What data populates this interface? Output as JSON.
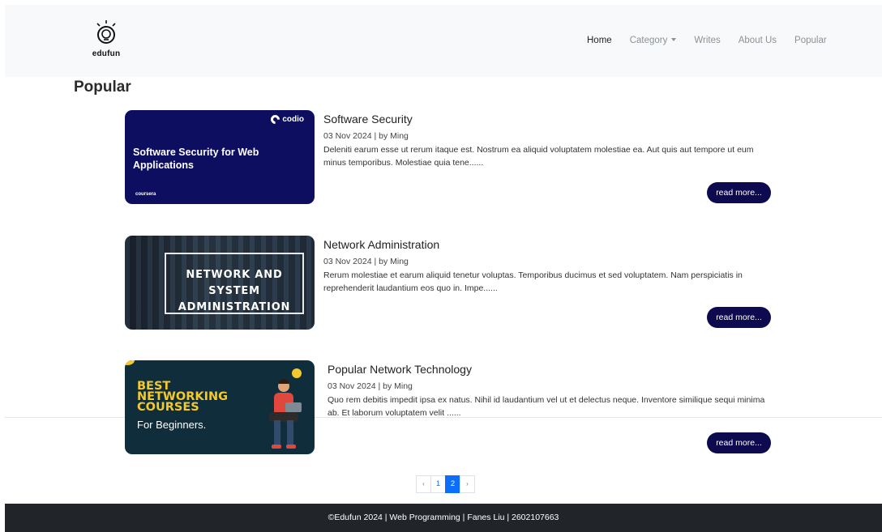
{
  "brand": {
    "name": "edufun",
    "icon": "lightbulb-icon"
  },
  "nav": {
    "items": [
      {
        "label": "Home",
        "active": true
      },
      {
        "label": "Category",
        "dropdown": true
      },
      {
        "label": "Writes"
      },
      {
        "label": "About Us"
      },
      {
        "label": "Popular"
      }
    ]
  },
  "page": {
    "title": "Popular"
  },
  "posts": [
    {
      "title": "Software Security",
      "meta": "03 Nov 2024 | by Ming",
      "excerpt": "Deleniti earum esse ut rerum itaque est. Nostrum ea aliquid voluptatem molestiae ea. Aut quis aut tempore ut eum minus temporibus. Molestiae quia tene......",
      "read_more": "read more...",
      "image": {
        "logo": "codio",
        "headline": "Software Security for Web Applications",
        "footer": "coursera"
      }
    },
    {
      "title": "Network Administration",
      "meta": "03 Nov 2024 | by Ming",
      "excerpt": "Rerum molestiae et earum aliquid tenetur voluptas. Temporibus ducimus et sed voluptatem. Nam perspiciatis in reprehenderit laudantium eos quo in. Impe......",
      "read_more": "read more...",
      "image": {
        "line1": "NETWORK AND SYSTEM",
        "line2": "ADMINISTRATION"
      }
    },
    {
      "title": "Popular Network Technology",
      "meta": "03 Nov 2024 | by Ming",
      "excerpt": "Quo rem debitis impedit ipsa ex natus. Nihil id laudantium vel ut et delectus neque. Inventore similique sequi minima ab. Et laborum voluptatem velit ......",
      "read_more": "read more...",
      "image": {
        "line1": "BEST",
        "line2": "NETWORKING",
        "line3": "COURSES",
        "sub": "For Beginners."
      }
    }
  ],
  "pagination": {
    "prev": "‹",
    "pages": [
      "1",
      "2"
    ],
    "current": "2",
    "next": "›"
  },
  "footer": {
    "text": "©Edufun 2024 | Web Programming | Fanes Liu | 2602107663"
  },
  "colors": {
    "button": "#0d0a4f",
    "footer_bg": "#212529",
    "navbar_bg": "#f8f9fa",
    "page_active": "#0d6efd"
  }
}
